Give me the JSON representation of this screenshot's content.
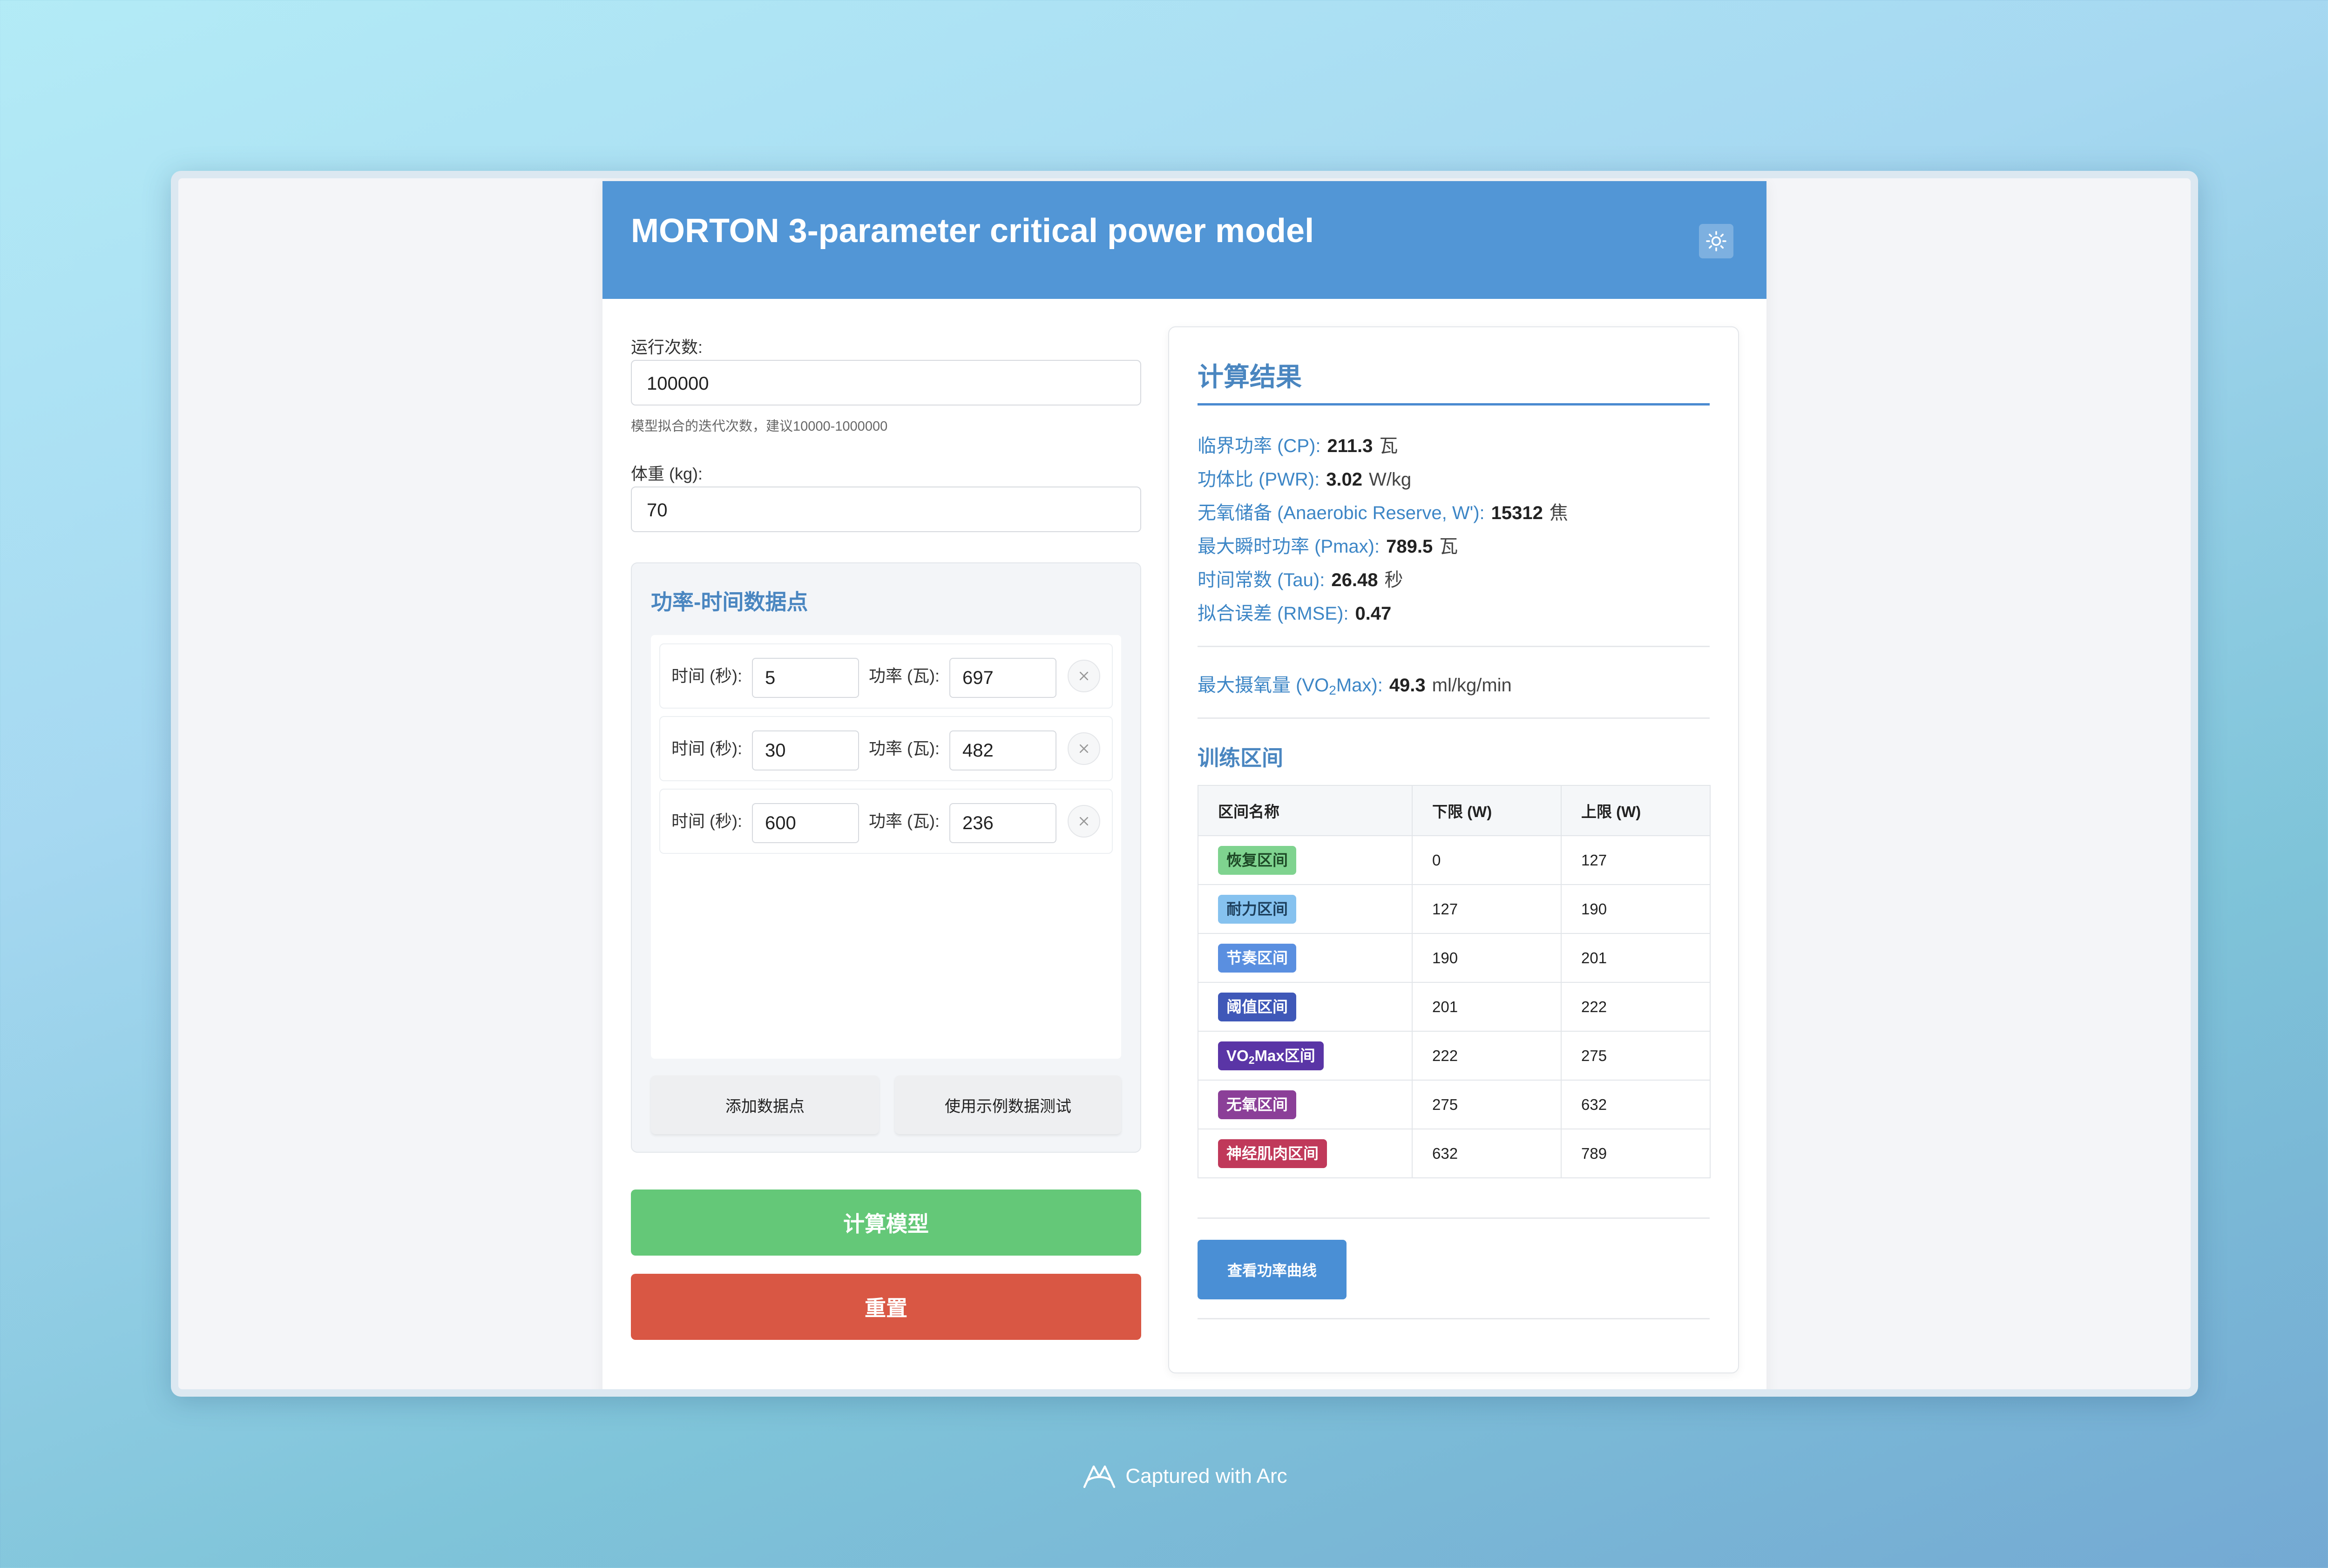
{
  "app": {
    "title": "MORTON 3-parameter critical power model"
  },
  "form": {
    "runs": {
      "label": "运行次数:",
      "value": "100000",
      "hint": "模型拟合的迭代次数，建议10000-1000000"
    },
    "weight": {
      "label": "体重 (kg):",
      "value": "70"
    }
  },
  "data_points": {
    "title": "功率-时间数据点",
    "time_label": "时间 (秒):",
    "power_label": "功率 (瓦):",
    "rows": [
      {
        "time": "5",
        "power": "697"
      },
      {
        "time": "30",
        "power": "482"
      },
      {
        "time": "600",
        "power": "236"
      }
    ],
    "add_button": "添加数据点",
    "example_button": "使用示例数据测试"
  },
  "actions": {
    "calculate": "计算模型",
    "reset": "重置"
  },
  "results": {
    "title": "计算结果",
    "metrics": [
      {
        "label": "临界功率 (CP):",
        "value": "211.3",
        "unit": "瓦"
      },
      {
        "label": "功体比 (PWR):",
        "value": "3.02",
        "unit": "W/kg"
      },
      {
        "label": "无氧储备 (Anaerobic Reserve, W'):",
        "value": "15312",
        "unit": "焦"
      },
      {
        "label": "最大瞬时功率 (Pmax):",
        "value": "789.5",
        "unit": "瓦"
      },
      {
        "label": "时间常数 (Tau):",
        "value": "26.48",
        "unit": "秒"
      },
      {
        "label": "拟合误差 (RMSE):",
        "value": "0.47",
        "unit": ""
      }
    ],
    "vo2max": {
      "label_pre": "最大摄氧量 (VO",
      "label_sub": "2",
      "label_post": "Max):",
      "value": "49.3",
      "unit": "ml/kg/min"
    },
    "zones_title": "训练区间",
    "zone_headers": [
      "区间名称",
      "下限 (W)",
      "上限 (W)"
    ],
    "zones": [
      {
        "name": "恢复区间",
        "low": "0",
        "high": "127",
        "color": "#7fd38f",
        "text_color": "#1e4a27"
      },
      {
        "name": "耐力区间",
        "low": "127",
        "high": "190",
        "color": "#86c2ef",
        "text_color": "#1d3f5c"
      },
      {
        "name": "节奏区间",
        "low": "190",
        "high": "201",
        "color": "#5a8fe0",
        "text_color": "#ffffff"
      },
      {
        "name": "阈值区间",
        "low": "201",
        "high": "222",
        "color": "#3f58b8",
        "text_color": "#ffffff"
      },
      {
        "name_pre": "VO",
        "name_sub": "2",
        "name_post": "Max区间",
        "low": "222",
        "high": "275",
        "color": "#5a35a6",
        "text_color": "#ffffff"
      },
      {
        "name": "无氧区间",
        "low": "275",
        "high": "632",
        "color": "#8b3f98",
        "text_color": "#ffffff"
      },
      {
        "name": "神经肌肉区间",
        "low": "632",
        "high": "789",
        "color": "#c0395a",
        "text_color": "#ffffff"
      }
    ],
    "curve_button": "查看功率曲线"
  },
  "footer": {
    "text": "Captured with Arc"
  },
  "colors": {
    "header": "#5296d6",
    "accent": "#4a86c0",
    "calculate": "#64c878",
    "reset": "#d95744"
  }
}
